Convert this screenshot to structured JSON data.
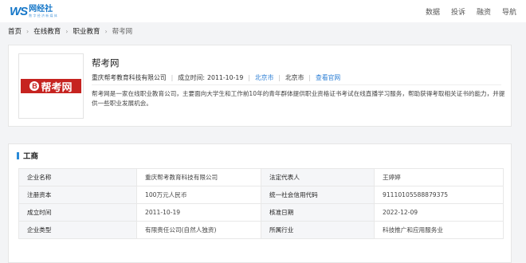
{
  "header": {
    "logo_ws": "WS",
    "logo_main": "网经社",
    "logo_sub": "数 字 经 济 新 媒 体",
    "nav": [
      "数据",
      "投诉",
      "融资",
      "导航"
    ]
  },
  "breadcrumb": [
    "首页",
    "在线教育",
    "职业教育",
    "帮考网"
  ],
  "company": {
    "logo_badge": "B",
    "logo_text": "帮考网",
    "name": "帮考网",
    "legal_name": "重庆帮考教育科技有限公司",
    "founded_label": "成立时间:",
    "founded": "2011-10-19",
    "city_link": "北京市",
    "city": "北京市",
    "website_link": "查看官网",
    "description": "帮考网是一家在线职业教育公司，主要面向大学生和工作前10年的青年群体提供职业资格证书考试在线直播学习服务，帮助获得考取相关证书的能力，并提供一些职业发展机会。"
  },
  "business": {
    "title": "工商",
    "rows": [
      {
        "k1": "企业名称",
        "v1": "重庆帮考教育科技有限公司",
        "k2": "法定代表人",
        "v2": "王婷婷"
      },
      {
        "k1": "注册资本",
        "v1": "100万元人民币",
        "k2": "统一社会信用代码",
        "v2": "91110105588879375"
      },
      {
        "k1": "成立时间",
        "v1": "2011-10-19",
        "k2": "核准日期",
        "v2": "2022-12-09"
      },
      {
        "k1": "企业类型",
        "v1": "有限责任公司(自然人独资)",
        "k2": "所属行业",
        "v2": "科技推广和应用服务业"
      }
    ]
  },
  "colors": {
    "accent": "#2a8ad8",
    "link": "#2a7dd4",
    "brand_red": "#c62320"
  }
}
